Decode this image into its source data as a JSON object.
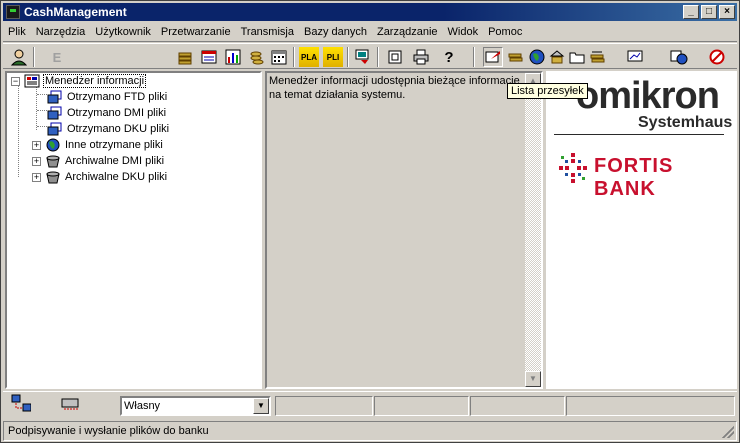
{
  "window": {
    "title": "CashManagement"
  },
  "menu": [
    "Plik",
    "Narzędzia",
    "Użytkownik",
    "Przetwarzanie",
    "Transmisja",
    "Bazy danych",
    "Zarządzanie",
    "Widok",
    "Pomoc"
  ],
  "toolbar": {
    "pla_label": "PLA",
    "pli_label": "PLI",
    "e_label": "E",
    "help_label": "?"
  },
  "tree": {
    "root": "Menedżer informacji",
    "items": [
      {
        "label": "Otrzymano FTD pliki",
        "icon": "network-file-icon"
      },
      {
        "label": "Otrzymano DMI pliki",
        "icon": "network-file-icon"
      },
      {
        "label": "Otrzymano DKU pliki",
        "icon": "network-file-icon"
      },
      {
        "label": "Inne otrzymane pliki",
        "icon": "globe-icon",
        "expandable": true
      },
      {
        "label": "Archiwalne DMI pliki",
        "icon": "archive-icon",
        "expandable": true
      },
      {
        "label": "Archiwalne DKU pliki",
        "icon": "archive-icon",
        "expandable": true
      }
    ]
  },
  "info": {
    "text": "Menedżer informacji udostępnia bieżące informacje na temat działania systemu."
  },
  "tooltip": {
    "text": "Lista przesyłek"
  },
  "logos": {
    "omikron": "omikron",
    "systemhaus": "Systemhaus",
    "fortis": "FORTIS BANK"
  },
  "bottom": {
    "combo_value": "Własny"
  },
  "status": {
    "text": "Podpisywanie i wysłanie plików do banku"
  },
  "colors": {
    "title_bar": "#0a246a",
    "fortis_red": "#c8102e",
    "tooltip_bg": "#ffffe1"
  }
}
